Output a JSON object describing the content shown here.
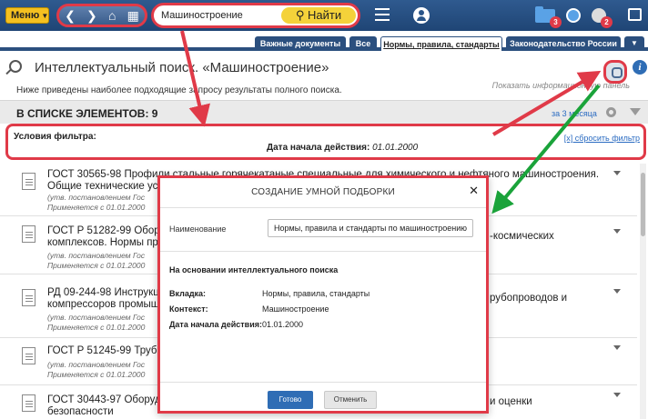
{
  "topbar": {
    "menu_label": "Меню",
    "search_value": "Машиностроение",
    "find_label": "Найти",
    "badges": {
      "folder": "3",
      "bell": "2"
    }
  },
  "tabs": [
    {
      "label": "Важные документы"
    },
    {
      "label": "Все"
    },
    {
      "label": "Нормы, правила, стандарты"
    },
    {
      "label": "Законодательство России"
    }
  ],
  "header": {
    "title": "Интеллектуальный поиск. «Машиностроение»",
    "subtitle": "Ниже приведены наиболее подходящие запросу результаты полного поиска.",
    "info_link": "Показать информационную панель"
  },
  "list_bar": {
    "count_label": "В СПИСКЕ ЭЛЕМЕНТОВ: 9",
    "period": "за 3 месяца"
  },
  "filter": {
    "label": "Условия фильтра:",
    "field": "Дата начала действия:",
    "value": "01.01.2000",
    "reset": "[x] сбросить фильтр"
  },
  "documents": [
    {
      "title_line1": "ГОСТ 30565-98 Профили стальные горячекатаные специальные для химического и нефтяного машиностроения.",
      "title_line2": "Общие технические усл",
      "meta1": "(утв. постановлением Гос",
      "meta2": "Применяется с 01.01.2000"
    },
    {
      "title_line1": "ГОСТ Р 51282-99 Обору",
      "title_tail": "-космических",
      "title_line2": "комплексов. Нормы про",
      "meta1": "(утв. постановлением Гос",
      "meta2": "Применяется с 01.01.2000"
    },
    {
      "title_line1": "РД 09-244-98 Инструкци",
      "title_tail": "рубопроводов и",
      "title_line2": "компрессоров промышл",
      "meta1": "(утв. постановлением Гос",
      "meta2": "Применяется с 01.01.2000"
    },
    {
      "title_line1": "ГОСТ Р 51245-99 Трубы",
      "meta1": "(утв. постановлением Гос",
      "meta2": "Применяется с 01.01.2000"
    },
    {
      "title_line1": "ГОСТ 30443-97 Оборудо",
      "title_tail": "и оценки",
      "title_line2": "безопасности"
    }
  ],
  "modal": {
    "title": "СОЗДАНИЕ УМНОЙ ПОДБОРКИ",
    "name_label": "Наименование",
    "name_value": "Нормы, правила и стандарты по машиностроению",
    "basis_label": "На основании интеллектуального поиска",
    "tab_label": "Вкладка:",
    "tab_value": "Нормы, правила, стандарты",
    "context_label": "Контекст:",
    "context_value": "Машиностроение",
    "date_label": "Дата начала действия:",
    "date_value": "01.01.2000",
    "ok": "Готово",
    "cancel": "Отменить"
  },
  "colors": {
    "highlight": "#e03a48",
    "arrow_green": "#1aa33a",
    "topbar": "#1f4575",
    "accent_yellow": "#f4c020"
  }
}
